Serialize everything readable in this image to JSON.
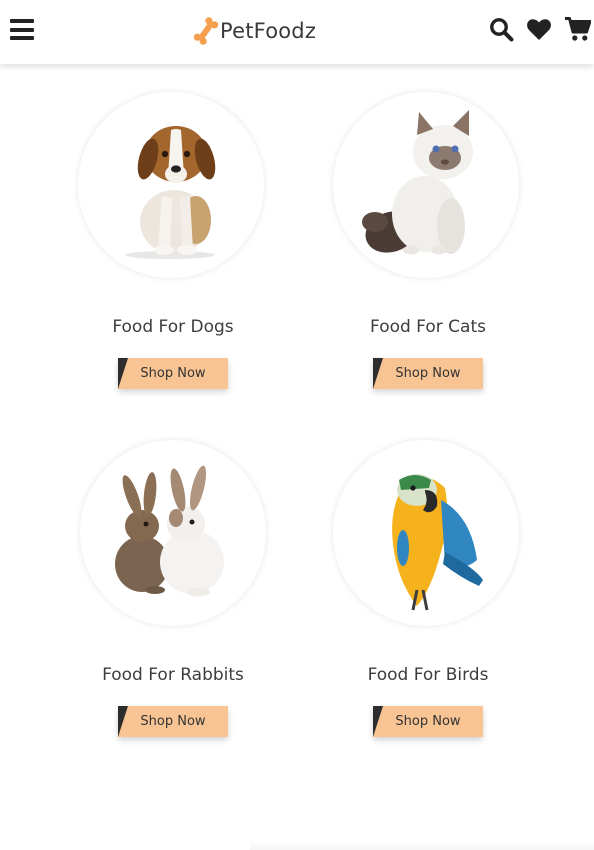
{
  "header": {
    "brand": "PetFoodz",
    "icons": {
      "menu": "hamburger-icon",
      "logo": "bone-icon",
      "search": "search-icon",
      "wishlist": "heart-icon",
      "cart": "cart-icon"
    },
    "logo_color": "#f5a04e"
  },
  "products": [
    {
      "title": "Food For Dogs",
      "button": "Shop Now",
      "image": "beagle-puppy-image"
    },
    {
      "title": "Food For Cats",
      "button": "Shop Now",
      "image": "fluffy-cat-image"
    },
    {
      "title": "Food For Rabbits",
      "button": "Shop Now",
      "image": "rabbits-image"
    },
    {
      "title": "Food For Birds",
      "button": "Shop Now",
      "image": "parrot-image"
    }
  ],
  "colors": {
    "button_bg": "#f8c493",
    "button_corner": "#2d2d2d",
    "text": "#3d3d3d"
  }
}
